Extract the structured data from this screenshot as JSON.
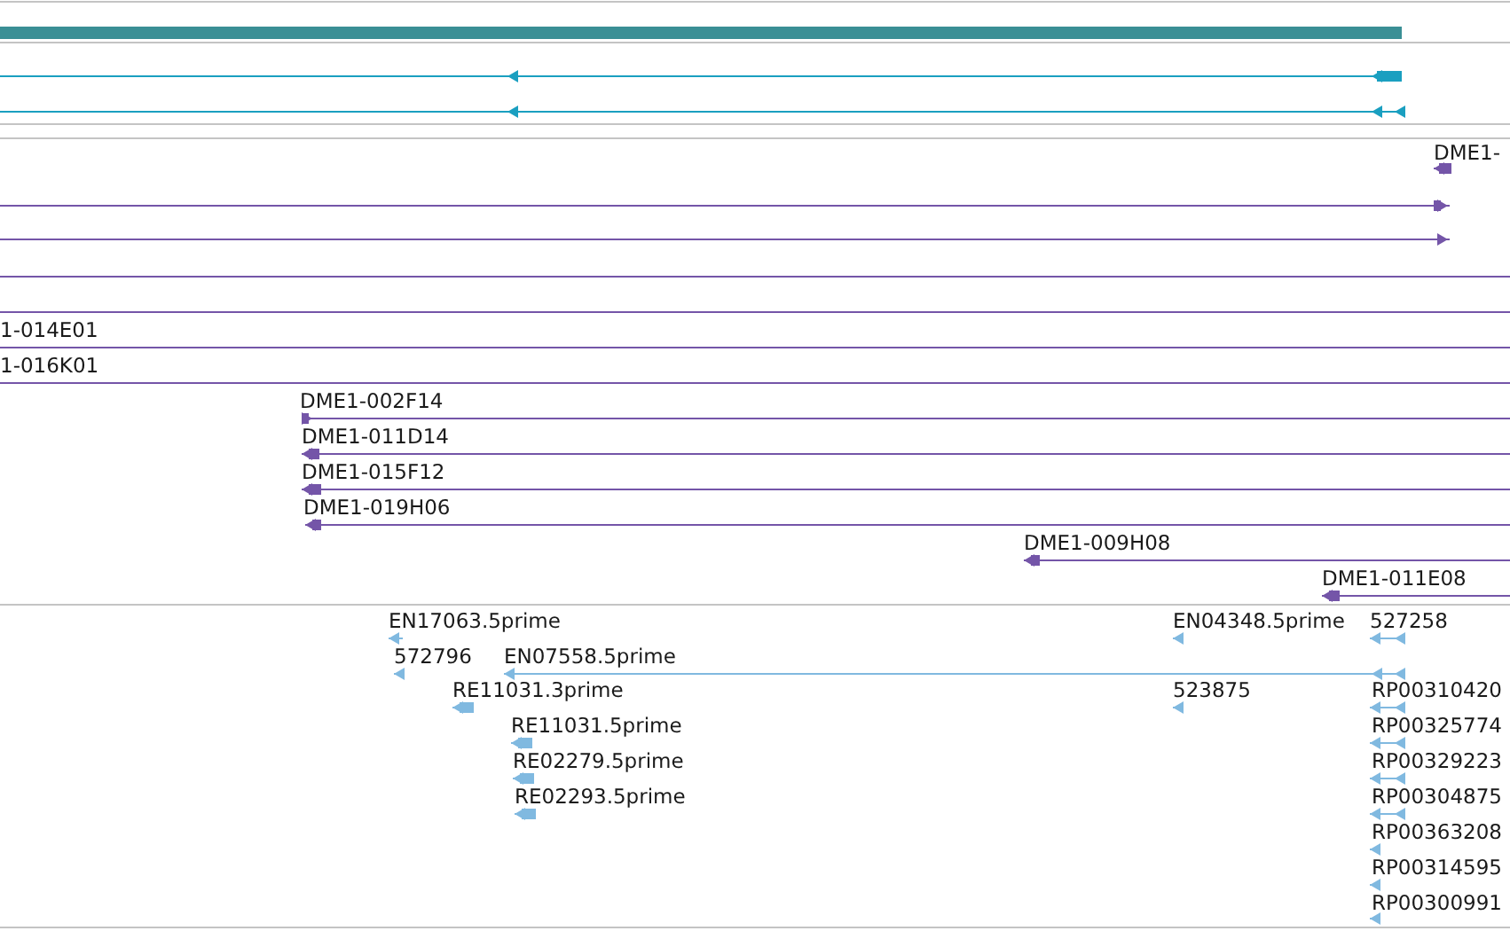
{
  "tracks": [
    {
      "kind": "gene"
    },
    {
      "kind": "transcript",
      "features": [
        {
          "kind": "arrow",
          "reverse": true
        },
        {
          "kind": "arrow",
          "reverse": true
        }
      ]
    },
    {
      "kind": "clone",
      "features": [
        {
          "label": "DME1-",
          "kind": "arrow",
          "reverse": true
        },
        {
          "kind": "arrow",
          "reverse": false
        },
        {
          "kind": "arrow",
          "reverse": false
        },
        {
          "kind": "line"
        },
        {
          "kind": "line"
        },
        {
          "label": "1-014E01",
          "kind": "line"
        },
        {
          "label": "1-016K01",
          "kind": "line"
        },
        {
          "label": "DME1-002F14",
          "kind": "arrow",
          "reverse": false
        },
        {
          "label": "DME1-011D14",
          "kind": "arrow",
          "reverse": true
        },
        {
          "label": "DME1-015F12",
          "kind": "arrow",
          "reverse": true
        },
        {
          "label": "DME1-019H06",
          "kind": "arrow",
          "reverse": true
        },
        {
          "label": "DME1-009H08",
          "kind": "arrow",
          "reverse": true
        },
        {
          "label": "DME1-011E08",
          "kind": "arrow",
          "reverse": true
        }
      ]
    },
    {
      "kind": "est",
      "features": [
        {
          "label": "EN17063.5prime",
          "kind": "arrow",
          "reverse": true
        },
        {
          "label": "EN04348.5prime",
          "kind": "arrow",
          "reverse": true
        },
        {
          "label": "527258",
          "kind": "arrow",
          "reverse": true
        },
        {
          "label": "572796",
          "kind": "arrow",
          "reverse": true
        },
        {
          "label": "EN07558.5prime",
          "kind": "arrow",
          "reverse": true
        },
        {
          "label": "RE11031.3prime",
          "kind": "arrow",
          "reverse": true
        },
        {
          "label": "523875",
          "kind": "arrow",
          "reverse": true
        },
        {
          "label": "RP00310420",
          "kind": "arrow",
          "reverse": true
        },
        {
          "label": "RE11031.5prime",
          "kind": "arrow",
          "reverse": true
        },
        {
          "label": "RP00325774",
          "kind": "arrow",
          "reverse": true
        },
        {
          "label": "RE02279.5prime",
          "kind": "arrow",
          "reverse": true
        },
        {
          "label": "RP00329223",
          "kind": "arrow",
          "reverse": true
        },
        {
          "label": "RE02293.5prime",
          "kind": "arrow",
          "reverse": true
        },
        {
          "label": "RP00304875",
          "kind": "arrow",
          "reverse": true
        },
        {
          "label": "RP00363208",
          "kind": "arrow",
          "reverse": true
        },
        {
          "label": "RP00314595",
          "kind": "arrow",
          "reverse": true
        },
        {
          "label": "RP00300991",
          "kind": "arrow",
          "reverse": true
        }
      ]
    }
  ]
}
